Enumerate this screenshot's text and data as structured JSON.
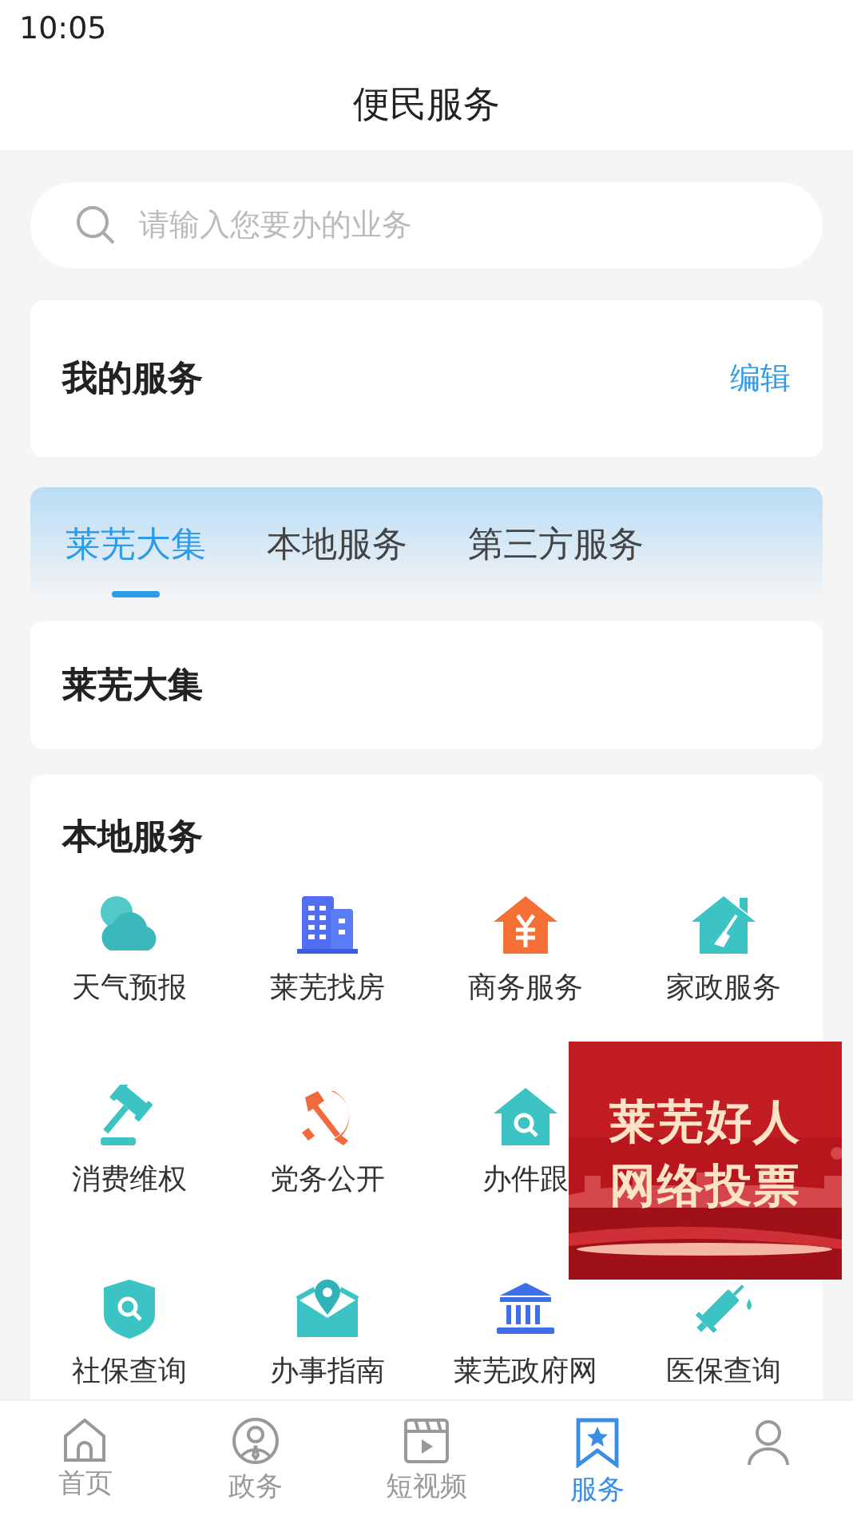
{
  "status_bar": {
    "time": "10:05"
  },
  "header": {
    "title": "便民服务"
  },
  "search": {
    "placeholder": "请输入您要办的业务"
  },
  "my_services": {
    "title": "我的服务",
    "action": "编辑"
  },
  "tabs": [
    {
      "label": "莱芜大集",
      "selected": true
    },
    {
      "label": "本地服务",
      "selected": false
    },
    {
      "label": "第三方服务",
      "selected": false
    }
  ],
  "section_laiwu": {
    "title": "莱芜大集"
  },
  "section_local": {
    "title": "本地服务",
    "items": [
      {
        "label": "天气预报"
      },
      {
        "label": "莱芜找房"
      },
      {
        "label": "商务服务"
      },
      {
        "label": "家政服务"
      },
      {
        "label": "消费维权"
      },
      {
        "label": "党务公开"
      },
      {
        "label": "办件跟"
      },
      {
        "label": "社保查询"
      },
      {
        "label": "办事指南"
      },
      {
        "label": "莱芜政府网"
      },
      {
        "label": "医保查询"
      }
    ]
  },
  "floating_banner": {
    "lines": [
      "莱芜好人",
      "网络投票"
    ]
  },
  "bottom_nav": [
    {
      "label": "首页",
      "selected": false
    },
    {
      "label": "政务",
      "selected": false
    },
    {
      "label": "短视频",
      "selected": false
    },
    {
      "label": "服务",
      "selected": true
    },
    {
      "selected": false
    }
  ]
}
